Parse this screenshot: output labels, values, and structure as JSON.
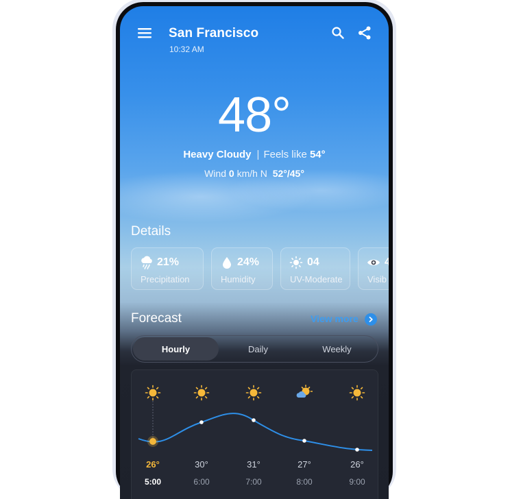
{
  "header": {
    "city": "San Francisco",
    "time": "10:32 AM"
  },
  "current": {
    "temperature": "48°",
    "condition": "Heavy Cloudy",
    "separator": "|",
    "feels_like_label": "Feels like",
    "feels_like_value": "54°",
    "wind_label": "Wind",
    "wind_value": "0",
    "wind_unit": "km/h N",
    "high_low": "52°/45°"
  },
  "details": {
    "title": "Details",
    "cards": [
      {
        "icon": "rain-cloud-icon",
        "value": "21%",
        "label": "Precipitation"
      },
      {
        "icon": "drop-icon",
        "value": "24%",
        "label": "Humidity"
      },
      {
        "icon": "sun-icon",
        "value": "04",
        "label": "UV-Moderate"
      },
      {
        "icon": "eye-icon",
        "value": "4",
        "label": "Visib"
      }
    ]
  },
  "forecast": {
    "title": "Forecast",
    "view_more": "View more",
    "tabs": [
      {
        "label": "Hourly",
        "active": true
      },
      {
        "label": "Daily",
        "active": false
      },
      {
        "label": "Weekly",
        "active": false
      }
    ],
    "hours": [
      {
        "icon": "sun-icon",
        "temp": "26°",
        "time": "5:00",
        "now": true
      },
      {
        "icon": "sun-icon",
        "temp": "30°",
        "time": "6:00",
        "now": false
      },
      {
        "icon": "sun-icon",
        "temp": "31°",
        "time": "7:00",
        "now": false
      },
      {
        "icon": "partly-cloudy-icon",
        "temp": "27°",
        "time": "8:00",
        "now": false
      },
      {
        "icon": "sun-icon",
        "temp": "26°",
        "time": "9:00",
        "now": false
      }
    ]
  },
  "colors": {
    "accent": "#3d9cf0",
    "sun": "#f5b83a",
    "now": "#f3b73b",
    "curve": "#2e8fe8"
  }
}
